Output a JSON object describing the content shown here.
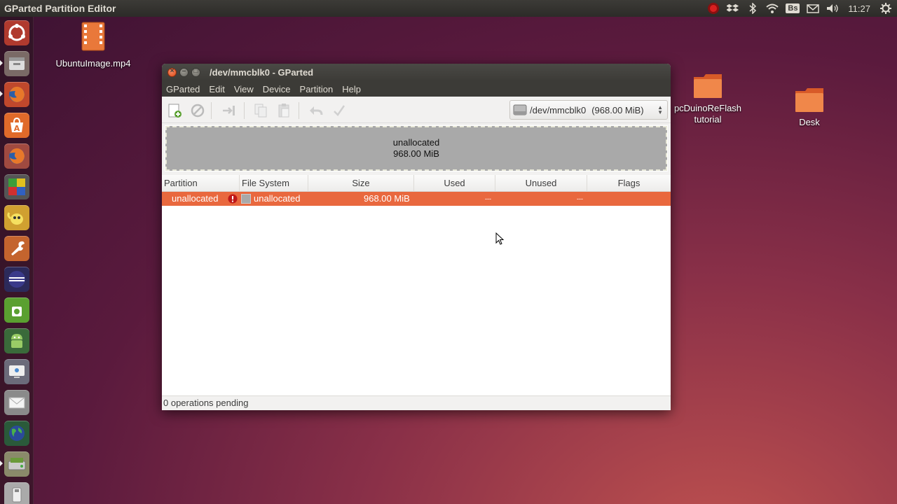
{
  "panel": {
    "app_title": "GParted Partition Editor",
    "clock": "11:27",
    "keyboard_layout": "Bs",
    "indicators": [
      "record-icon",
      "dropbox-icon",
      "bluetooth-icon",
      "wifi-icon",
      "keyboard-icon",
      "mail-icon",
      "volume-icon",
      "gear-icon"
    ]
  },
  "launcher": {
    "items": [
      "dash-icon",
      "files-icon",
      "firefox-icon",
      "software-center-icon",
      "firefox-icon",
      "libreoffice-icon",
      "teapot-icon",
      "wrench-app-icon",
      "eclipse-icon",
      "android-sdk-icon",
      "android-icon",
      "screen-icon",
      "mail-client-icon",
      "globe-icon",
      "gparted-icon",
      "usb-icon"
    ]
  },
  "desktop": {
    "icons": [
      {
        "label": "UbuntuImage.mp4",
        "kind": "video-file-icon"
      },
      {
        "label": "pcDuinoReFlash\ntutorial",
        "kind": "folder-icon"
      },
      {
        "label": "Desk",
        "kind": "folder-icon"
      }
    ]
  },
  "window": {
    "title": "/dev/mmcblk0 - GParted",
    "menu": [
      "GParted",
      "Edit",
      "View",
      "Device",
      "Partition",
      "Help"
    ],
    "device": {
      "path": "/dev/mmcblk0",
      "size": "(968.00 MiB)"
    },
    "graph": {
      "label": "unallocated",
      "size": "968.00 MiB"
    },
    "table": {
      "columns": [
        "Partition",
        "File System",
        "Size",
        "Used",
        "Unused",
        "Flags"
      ],
      "rows": [
        {
          "partition": "unallocated",
          "filesystem": "unallocated",
          "size": "968.00 MiB",
          "used": "---",
          "unused": "---",
          "flags": ""
        }
      ]
    },
    "status": "0 operations pending"
  },
  "colors": {
    "selection": "#e9683e",
    "panel": "#3c3b37",
    "close_button": "#df4a16"
  }
}
